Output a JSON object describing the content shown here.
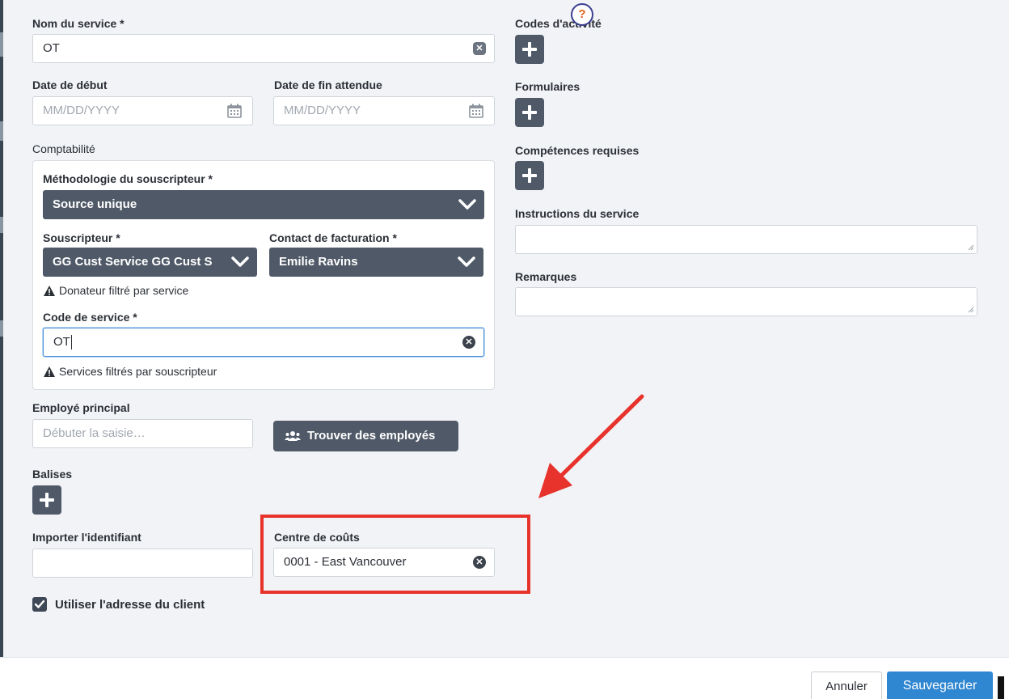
{
  "form": {
    "nom_service": {
      "label": "Nom du service *",
      "value": "OT"
    },
    "date_debut": {
      "label": "Date de début",
      "placeholder": "MM/DD/YYYY"
    },
    "date_fin": {
      "label": "Date de fin attendue",
      "placeholder": "MM/DD/YYYY"
    },
    "comptabilite": {
      "label": "Comptabilité",
      "methodologie": {
        "label": "Méthodologie du souscripteur *",
        "value": "Source unique"
      },
      "souscripteur": {
        "label": "Souscripteur *",
        "value": "GG Cust Service GG Cust S"
      },
      "contact": {
        "label": "Contact de facturation *",
        "value": "Emilie Ravins"
      },
      "donateur_warning": "Donateur filtré par service",
      "code_service": {
        "label": "Code de service *",
        "value": "OT"
      },
      "services_warning": "Services filtrés par souscripteur"
    },
    "employe_principal": {
      "label": "Employé principal",
      "placeholder": "Débuter la saisie…"
    },
    "trouver_employes": "Trouver des employés",
    "balises": {
      "label": "Balises"
    },
    "importer_identifiant": {
      "label": "Importer l'identifiant",
      "value": ""
    },
    "centre_couts": {
      "label": "Centre de coûts",
      "value": "0001 - East Vancouver"
    },
    "utiliser_adresse": {
      "label": "Utiliser l'adresse du client",
      "checked": true
    },
    "codes_activite": {
      "label": "Codes d'activité"
    },
    "formulaires": {
      "label": "Formulaires"
    },
    "competences": {
      "label": "Compétences requises"
    },
    "instructions": {
      "label": "Instructions du service"
    },
    "remarques": {
      "label": "Remarques"
    }
  },
  "help": {
    "symbol": "?"
  },
  "footer": {
    "cancel_label": "Annuler",
    "save_label": "Sauvegarder"
  },
  "colors": {
    "accent": "#2f86d1",
    "dark_button": "#4f5967",
    "highlight": "#e8322c"
  }
}
